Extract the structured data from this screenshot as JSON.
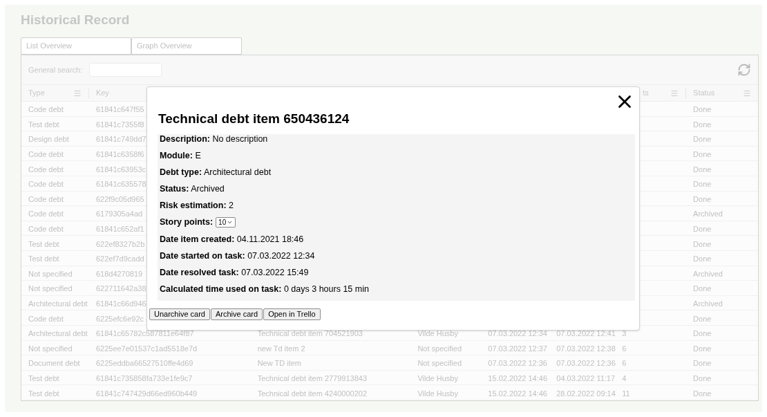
{
  "title": "Historical Record",
  "tabs": [
    {
      "label": "List Overview"
    },
    {
      "label": "Graph Overview"
    }
  ],
  "search": {
    "label": "General search:"
  },
  "table": {
    "header": {
      "type": "Type",
      "key": "Key",
      "column_7": "ts",
      "status": "Status"
    },
    "rows": [
      {
        "type": "Code debt",
        "key": "61841c647f55",
        "status": "Done"
      },
      {
        "type": "Test debt",
        "key": "61841c7355f8",
        "status": "Done"
      },
      {
        "type": "Design debt",
        "key": "61841c749dd7",
        "status": "Done"
      },
      {
        "type": "Code debt",
        "key": "61841c6358f6",
        "status": "Done"
      },
      {
        "type": "Code debt",
        "key": "61841c63953c",
        "status": "Done"
      },
      {
        "type": "Code debt",
        "key": "61841c635578",
        "status": "Done"
      },
      {
        "type": "Code debt",
        "key": "622f9c05d965",
        "status": "Done"
      },
      {
        "type": "Code debt",
        "key": "6179305a4ad",
        "status": "Archived"
      },
      {
        "type": "Code debt",
        "key": "61841c652af1",
        "status": "Done"
      },
      {
        "type": "Test debt",
        "key": "622ef8327b2b",
        "status": "Done"
      },
      {
        "type": "Test debt",
        "key": "622ef7d9cadd",
        "status": "Done"
      },
      {
        "type": "Not specified",
        "key": "618d4270819",
        "status": "Archived"
      },
      {
        "type": "Not specified",
        "key": "622711642a38",
        "status": "Done"
      },
      {
        "type": "Architectural debt",
        "key": "61841c66d946",
        "status": "Archived"
      },
      {
        "type": "Code debt",
        "key": "6225efc6e92c",
        "status": "Done"
      },
      {
        "type": "Architectural debt",
        "key": "61841c65782c587811e64f87",
        "name": "Technical debt item 704521903",
        "responsible": "Vilde Husby",
        "created": "07.03.2022 12:34",
        "resolved": "07.03.2022 12:41",
        "points": "3",
        "status": "Done"
      },
      {
        "type": "Not specified",
        "key": "6225ee7e01537c1ad5518e7d",
        "name": "new Td item 2",
        "responsible": "Not specified",
        "created": "07.03.2022 12:37",
        "resolved": "07.03.2022 12:38",
        "points": "6",
        "status": "Done"
      },
      {
        "type": "Document debt",
        "key": "6225eddba66527510ffe4d69",
        "name": "New TD item",
        "responsible": "Not specified",
        "created": "07.03.2022 12:36",
        "resolved": "07.03.2022 12:36",
        "points": "6",
        "status": "Done"
      },
      {
        "type": "Test debt",
        "key": "61841c735858fa733e1fe9c7",
        "name": "Technical debt item 2779913843",
        "responsible": "Vilde Husby",
        "created": "15.02.2022 14:46",
        "resolved": "04.03.2022 11:17",
        "points": "4",
        "status": "Done"
      },
      {
        "type": "Test debt",
        "key": "61841c747429d66ed960b449",
        "name": "Technical debt item 4240000202",
        "responsible": "Vilde Husby",
        "created": "15.02.2022 14:46",
        "resolved": "28.02.2022 09:14",
        "points": "11",
        "status": "Done"
      }
    ]
  },
  "modal": {
    "title": "Technical debt item 650436124",
    "fields": [
      {
        "kind": "text",
        "label": "Description:",
        "value": "No description"
      },
      {
        "kind": "text",
        "label": "Module:",
        "value": "E"
      },
      {
        "kind": "text",
        "label": "Debt type:",
        "value": "Architectural debt"
      },
      {
        "kind": "text",
        "label": "Status:",
        "value": "Archived"
      },
      {
        "kind": "text",
        "label": "Risk estimation:",
        "value": "2"
      },
      {
        "kind": "select",
        "label": "Story points:",
        "value": "10"
      },
      {
        "kind": "text",
        "label": "Date item created:",
        "value": "04.11.2021 18:46"
      },
      {
        "kind": "text",
        "label": "Date started on task:",
        "value": "07.03.2022 12:34"
      },
      {
        "kind": "text",
        "label": "Date resolved task:",
        "value": "07.03.2022 15:49"
      },
      {
        "kind": "text",
        "label": "Calculated time used on task:",
        "value": "0 days 3 hours 15 min"
      }
    ],
    "buttons": [
      "Unarchive card",
      "Archive card",
      "Open in Trello"
    ]
  }
}
